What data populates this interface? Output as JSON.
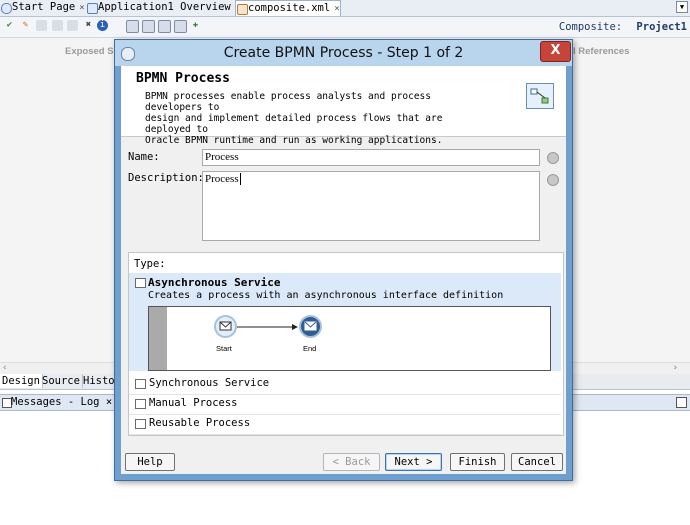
{
  "tabs": [
    {
      "label": "Start Page",
      "close": "×"
    },
    {
      "label": "Application1 Overview",
      "close": "×"
    },
    {
      "label": "composite.xml",
      "close": "×"
    }
  ],
  "composite": {
    "label": "Composite:",
    "value": "Project1"
  },
  "canvas": {
    "left_header": "Exposed Ser",
    "right_header": "l References"
  },
  "editor_tabs": [
    "Design",
    "Source",
    "Histo"
  ],
  "log": {
    "label": "Messages - Log ×"
  },
  "dialog": {
    "title": "Create BPMN Process - Step 1 of 2",
    "close": "X",
    "header_title": "BPMN Process",
    "header_desc": "BPMN processes enable process analysts and process developers to\ndesign and implement detailed process flows that are deployed to\nOracle BPMN runtime and run as working applications.",
    "name_label": "Name:",
    "name_value": "Process",
    "description_label": "Description:",
    "description_value": "Process",
    "type_label": "Type:",
    "types": [
      {
        "label": "Asynchronous Service",
        "desc": "Creates a process with an asynchronous interface definition",
        "selected": true
      },
      {
        "label": "Synchronous Service"
      },
      {
        "label": "Manual Process"
      },
      {
        "label": "Reusable Process"
      }
    ],
    "preview": {
      "start": "Start",
      "end": "End"
    },
    "buttons": {
      "help": "Help",
      "back": "< Back",
      "next": "Next >",
      "finish": "Finish",
      "cancel": "Cancel"
    }
  }
}
